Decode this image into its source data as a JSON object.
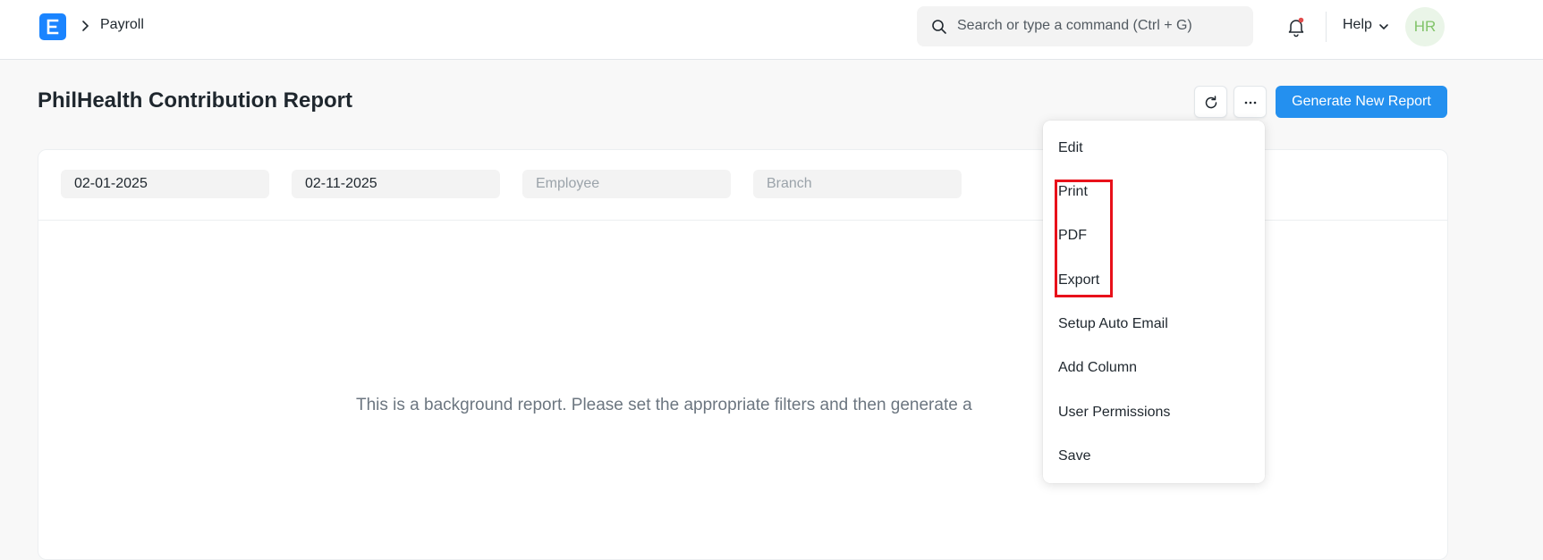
{
  "navbar": {
    "breadcrumb": "Payroll",
    "search_placeholder": "Search or type a command (Ctrl + G)",
    "help_label": "Help",
    "avatar_initials": "HR"
  },
  "page": {
    "title": "PhilHealth Contribution Report",
    "primary_button": "Generate New Report"
  },
  "filters": [
    {
      "value": "02-01-2025",
      "placeholder": ""
    },
    {
      "value": "02-11-2025",
      "placeholder": ""
    },
    {
      "value": "",
      "placeholder": "Employee"
    },
    {
      "value": "",
      "placeholder": "Branch"
    }
  ],
  "empty_message": "This is a background report. Please set the appropriate filters and then generate a",
  "menu": {
    "items": [
      "Edit",
      "Print",
      "PDF",
      "Export",
      "Setup Auto Email",
      "Add Column",
      "User Permissions",
      "Save"
    ],
    "highlighted": [
      "Print",
      "PDF",
      "Export"
    ]
  },
  "colors": {
    "accent": "#2490ef",
    "logo": "#1a84ff",
    "highlight": "#e8111a",
    "notification_dot": "#e24c4c",
    "avatar_text": "#82c46a"
  },
  "icons": [
    "app-logo-icon",
    "chevron-right-icon",
    "search-icon",
    "bell-icon",
    "chevron-down-icon",
    "refresh-icon",
    "more-horizontal-icon"
  ]
}
